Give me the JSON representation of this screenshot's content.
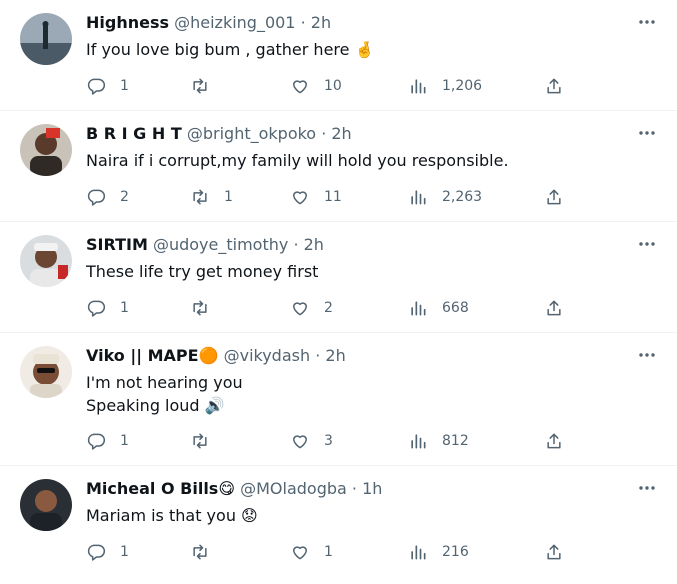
{
  "tweets": [
    {
      "name": "Highness",
      "handle": "@heizking_001",
      "time": "2h",
      "lines": [
        "If you love big bum , gather here 🤞"
      ],
      "replies": "1",
      "retweets": "",
      "likes": "10",
      "views": "1,206"
    },
    {
      "name": "B R I G H T",
      "handle": "@bright_okpoko",
      "time": "2h",
      "lines": [
        "Naira if i corrupt,my family will hold you responsible."
      ],
      "replies": "2",
      "retweets": "1",
      "likes": "11",
      "views": "2,263"
    },
    {
      "name": "SIRTIM",
      "handle": "@udoye_timothy",
      "time": "2h",
      "lines": [
        "These life try get money first"
      ],
      "replies": "1",
      "retweets": "",
      "likes": "2",
      "views": "668"
    },
    {
      "name": "Viko || MAPE🟠",
      "handle": "@vikydash",
      "time": "2h",
      "lines": [
        "I'm not hearing you",
        "Speaking loud 🔊"
      ],
      "replies": "1",
      "retweets": "",
      "likes": "3",
      "views": "812"
    },
    {
      "name": "Micheal O Bills😋",
      "handle": "@MOladogba",
      "time": "1h",
      "lines": [
        "Mariam is that you 😟"
      ],
      "replies": "1",
      "retweets": "",
      "likes": "1",
      "views": "216"
    }
  ],
  "separator": "·",
  "colors": {
    "text": "#0f1419",
    "secondary": "#536471",
    "divider": "#eff3f4"
  },
  "icons": [
    "more-icon",
    "reply-icon",
    "retweet-icon",
    "like-icon",
    "views-icon",
    "share-icon"
  ]
}
